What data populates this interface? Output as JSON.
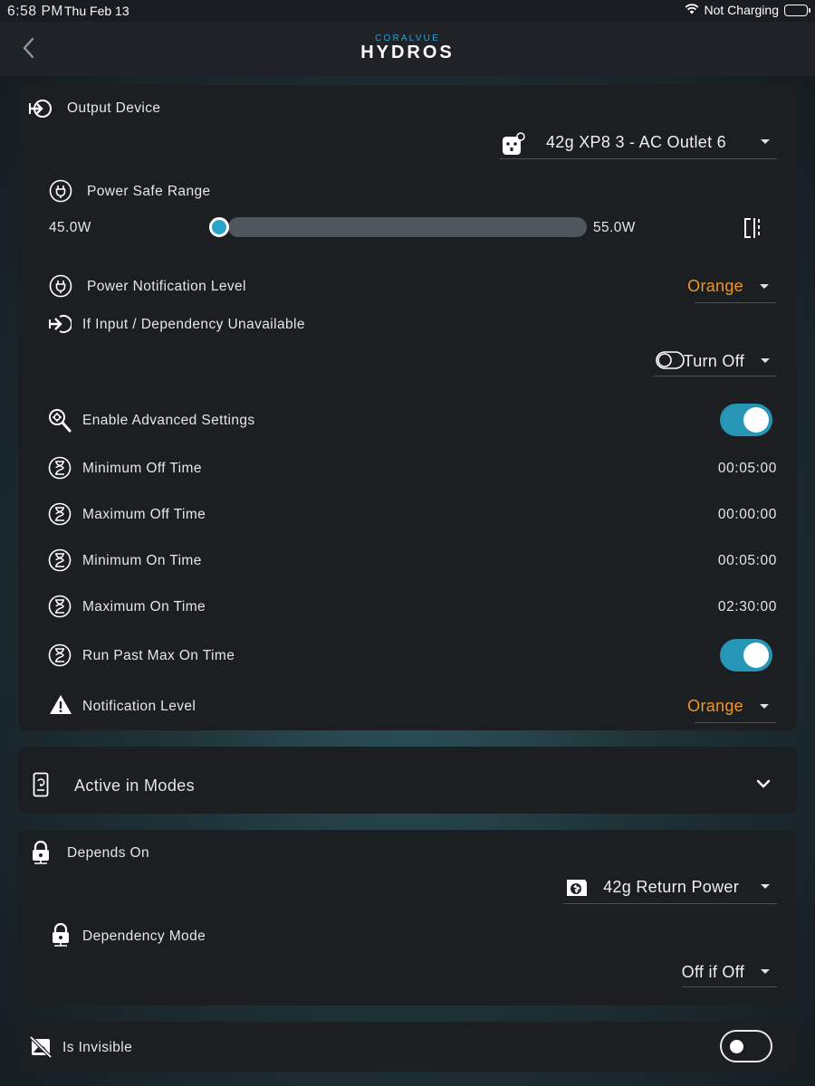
{
  "status_bar": {
    "time": "6:58 PM",
    "date": "Thu Feb 13",
    "charging": "Not Charging"
  },
  "header": {
    "logo_brand": "CORALVUE",
    "logo_title": "HYDROS"
  },
  "output_card": {
    "title": "Output Device",
    "device_value": "42g XP8 3 - AC Outlet 6",
    "power_safe_range": {
      "label": "Power Safe Range",
      "min": "45.0W",
      "max": "55.0W",
      "low_fraction": 0,
      "high_fraction": 1
    },
    "power_notification": {
      "label": "Power Notification Level",
      "value": "Orange"
    },
    "unavailable": {
      "label": "If Input / Dependency Unavailable",
      "value": "Turn Off"
    },
    "advanced": {
      "label": "Enable  Advanced Settings",
      "enabled": true
    },
    "rows": [
      {
        "label": "Minimum Off Time",
        "value": "00:05:00"
      },
      {
        "label": "Maximum Off Time",
        "value": "00:00:00"
      },
      {
        "label": "Minimum On Time",
        "value": "00:05:00"
      },
      {
        "label": "Maximum On Time",
        "value": "02:30:00"
      }
    ],
    "run_past": {
      "label": "Run Past Max On Time",
      "enabled": true
    },
    "notification": {
      "label": "Notification Level",
      "value": "Orange"
    }
  },
  "modes_card": {
    "title": "Active in Modes"
  },
  "depends_card": {
    "title": "Depends On",
    "device_value": "42g Return Power",
    "mode_label": "Dependency Mode",
    "mode_value": "Off if Off"
  },
  "invisible_card": {
    "label": "Is Invisible",
    "enabled": false
  },
  "colors": {
    "accent": "#2596b5",
    "orange": "#f29426",
    "card": "#1b1f22"
  }
}
